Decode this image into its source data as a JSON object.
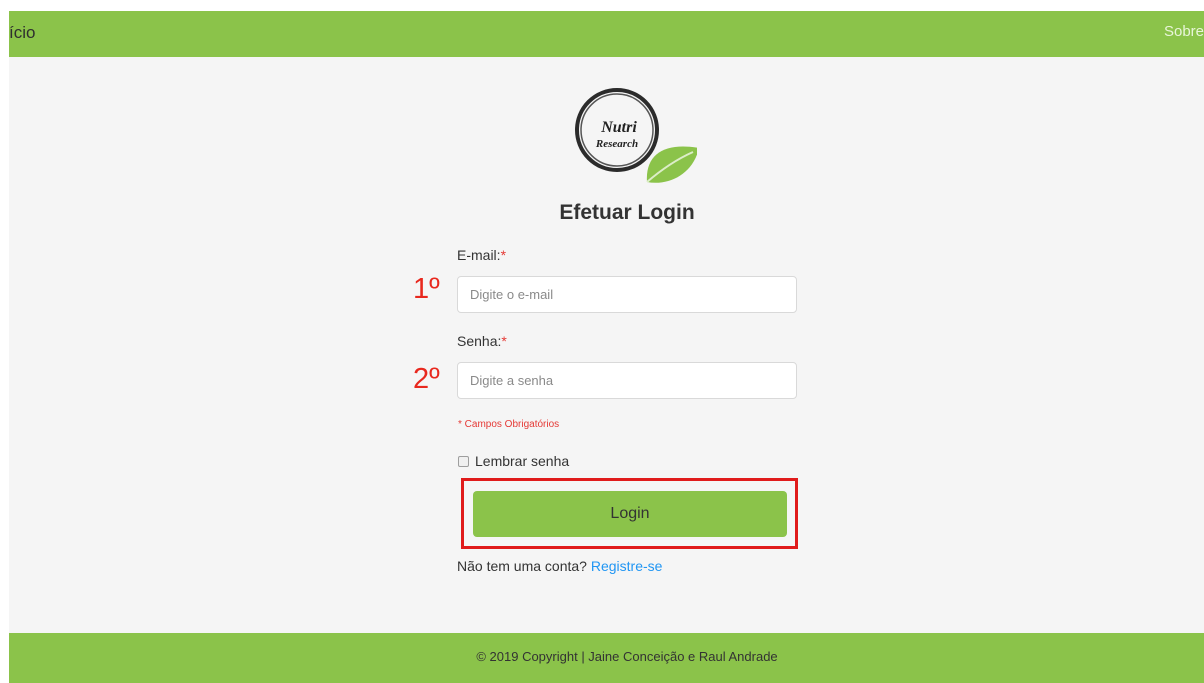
{
  "nav": {
    "home_label": "ício",
    "about_label": "Sobre"
  },
  "logo": {
    "line1": "Nutri",
    "line2": "Research"
  },
  "login_form": {
    "title": "Efetuar Login",
    "email": {
      "label": "E-mail:",
      "required_mark": "*",
      "placeholder": "Digite o e-mail",
      "value": "",
      "step_marker": "1º"
    },
    "password": {
      "label": "Senha:",
      "required_mark": "*",
      "placeholder": "Digite a senha",
      "value": "",
      "step_marker": "2º"
    },
    "required_note": "* Campos Obrigatórios",
    "remember": {
      "label": "Lembrar senha",
      "checked": false
    },
    "submit_label": "Login",
    "signup_prompt": "Não tem uma conta?",
    "signup_link": "Registre-se"
  },
  "footer": {
    "text": "© 2019 Copyright | Jaine Conceição e Raul Andrade"
  },
  "colors": {
    "brand_green": "#8bc34a",
    "annotation_red": "#e01b1b",
    "link_blue": "#2196f3",
    "page_background": "#f5f5f5"
  }
}
